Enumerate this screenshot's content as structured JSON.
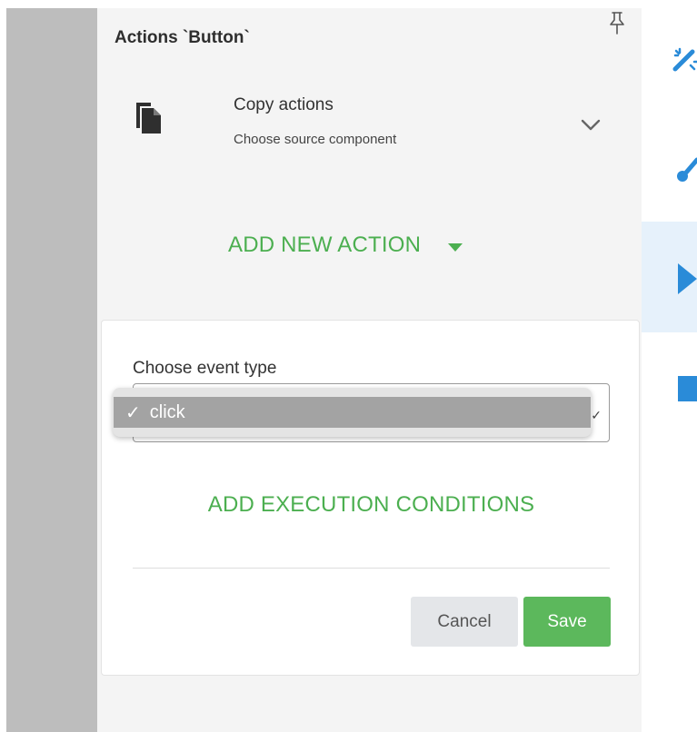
{
  "panel": {
    "title": "Actions `Button`",
    "icons": {
      "pin": "pin-icon"
    }
  },
  "copy_actions": {
    "title": "Copy actions",
    "subtitle": "Choose source component",
    "icon": "copy-icon",
    "chevron": "chevron-down-icon"
  },
  "add_new_action": {
    "label": "ADD NEW ACTION",
    "icon": "caret-down-icon"
  },
  "action_form": {
    "event_label": "Choose event type",
    "event_select": {
      "selected": "click",
      "options": [
        "click"
      ]
    },
    "add_execution_conditions": "ADD EXECUTION CONDITIONS",
    "cancel_label": "Cancel",
    "save_label": "Save"
  },
  "right_toolbar": {
    "icons": [
      "magic-wand-icon",
      "brush-icon",
      "play-icon",
      "stop-icon"
    ],
    "active": "play-icon"
  },
  "colors": {
    "accent_green": "#4caf50",
    "save_green": "#5cb85c",
    "toolbar_blue": "#2a8bd8",
    "panel_bg": "#f4f4f4",
    "gutter_gray": "#bdbdbd"
  }
}
